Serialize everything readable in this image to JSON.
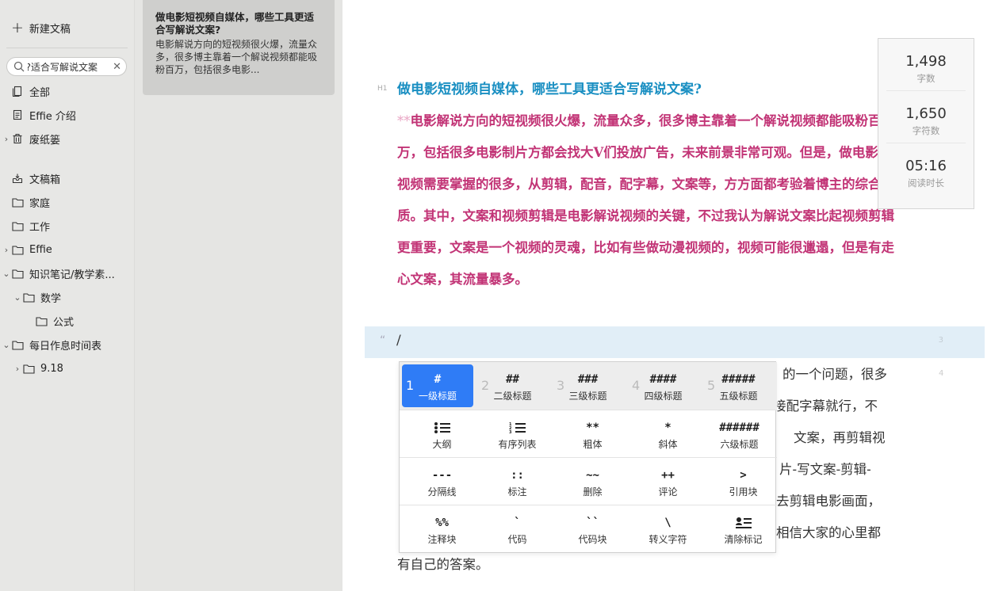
{
  "sidebar": {
    "new_doc": "新建文稿",
    "search_value": "适合写解说文案?",
    "items": [
      {
        "label": "全部",
        "icon": "all-docs-icon"
      },
      {
        "label": "Effie 介绍",
        "icon": "document-icon"
      },
      {
        "label": "废纸篓",
        "icon": "trash-icon"
      },
      {
        "label": "文稿箱",
        "icon": "inbox-icon"
      },
      {
        "label": "家庭",
        "icon": "folder-icon"
      },
      {
        "label": "工作",
        "icon": "folder-icon"
      },
      {
        "label": "Effie",
        "icon": "folder-icon"
      },
      {
        "label": "知识笔记/教学素...",
        "icon": "folder-icon"
      },
      {
        "label": "数学",
        "icon": "folder-icon"
      },
      {
        "label": "公式",
        "icon": "folder-icon"
      },
      {
        "label": "每日作息时间表",
        "icon": "folder-icon"
      },
      {
        "label": "9.18",
        "icon": "folder-icon"
      }
    ]
  },
  "doc_list": {
    "card_title": "做电影短视频自媒体，哪些工具更适合写解说文案?",
    "card_preview": "电影解说方向的短视频很火爆，流量众多，很多博主靠着一个解说视频都能吸粉百万，包括很多电影..."
  },
  "editor": {
    "h1_marker": "H1",
    "title": "做电影短视频自媒体，哪些工具更适合写解说文案?",
    "bold_marker": "**",
    "paragraph": "电影解说方向的短视频很火爆，流量众多，很多博主靠着一个解说视频都能吸粉百万，包括很多电影制片方都会找大V们投放广告，未来前景非常可观。但是，做电影短视频需要掌握的很多，从剪辑，配音，配字幕，文案等，方方面都考验着博主的综合素质。其中，文案和视频剪辑是电影解说视频的关键，不过我认为解说文案比起视频剪辑更重要，文案是一个视频的灵魂，比如有些做动漫视频的，视频可能很邋遢，但是有走心文案，其流量暴多。",
    "quote_marker": "“",
    "current_line": "/",
    "line3": "3",
    "line4": "4",
    "body_fragments": [
      "的一个问题，很多",
      "接配字幕就行，不",
      "文案，再剪辑视",
      "片-写文案-剪辑-",
      "去剪辑电影画面，",
      "相信大家的心里都"
    ],
    "body_last": "有自己的答案。"
  },
  "stats": [
    {
      "value": "1,498",
      "label": "字数"
    },
    {
      "value": "1,650",
      "label": "字符数"
    },
    {
      "value": "05:16",
      "label": "阅读时长"
    }
  ],
  "menu": {
    "row1": [
      {
        "num": "1",
        "sym": "#",
        "label": "一级标题"
      },
      {
        "num": "2",
        "sym": "##",
        "label": "二级标题"
      },
      {
        "num": "3",
        "sym": "###",
        "label": "三级标题"
      },
      {
        "num": "4",
        "sym": "####",
        "label": "四级标题"
      },
      {
        "num": "5",
        "sym": "#####",
        "label": "五级标题"
      }
    ],
    "row2": [
      {
        "sym": "",
        "label": "大纲"
      },
      {
        "sym": "",
        "label": "有序列表"
      },
      {
        "sym": "**",
        "label": "粗体"
      },
      {
        "sym": "*",
        "label": "斜体"
      },
      {
        "sym": "######",
        "label": "六级标题"
      }
    ],
    "row3": [
      {
        "sym": "---",
        "label": "分隔线"
      },
      {
        "sym": "::",
        "label": "标注"
      },
      {
        "sym": "~~",
        "label": "删除"
      },
      {
        "sym": "++",
        "label": "评论"
      },
      {
        "sym": ">",
        "label": "引用块"
      }
    ],
    "row4": [
      {
        "sym": "%%",
        "label": "注释块"
      },
      {
        "sym": "`",
        "label": "代码"
      },
      {
        "sym": "``",
        "label": "代码块"
      },
      {
        "sym": "\\",
        "label": "转义字符"
      },
      {
        "sym": "",
        "label": "清除标记"
      }
    ]
  },
  "colors": {
    "title": "#1a8fc2",
    "bold_paragraph": "#c23476",
    "menu_active": "#2f7cf6",
    "quote_bg": "#e1eef7"
  }
}
